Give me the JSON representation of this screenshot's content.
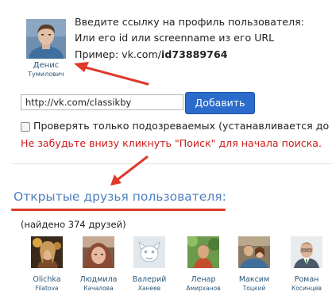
{
  "profile": {
    "first_name": "Денис",
    "last_name": "Тумилович"
  },
  "instructions": {
    "line1": "Введите ссылку на профиль пользователя:",
    "line2": "Или его id или screenname из его URL",
    "example_prefix": "Пример: vk.com/",
    "example_id": "id73889764"
  },
  "form": {
    "url_value": "http://vk.com/classikby",
    "add_button_label": "Добавить",
    "checkbox_label": "Проверять только подозреваемых (устанавливается до на",
    "checkbox_checked": false,
    "warning_text": "Не забудьте внизу кликнуть \"Поиск\" для начала поиска."
  },
  "friends_section": {
    "title": "Открытые друзья пользователя:",
    "count_text": "(найдено 374 друзей)"
  },
  "friends": [
    {
      "first": "Olichka",
      "last": "Filatova"
    },
    {
      "first": "Людмила",
      "last": "Качалова"
    },
    {
      "first": "Валерий",
      "last": "Ханеев"
    },
    {
      "first": "Ленар",
      "last": "Амирханов"
    },
    {
      "first": "Максим",
      "last": "Тоцкий"
    },
    {
      "first": "Роман",
      "last": "Косинцев"
    }
  ],
  "colors": {
    "link": "#2b587a",
    "section_title": "#4f7fbf",
    "button": "#2a6bcc",
    "warning": "#cc1a1a",
    "annotation": "#dd3a2a"
  },
  "icons": [
    "placeholder-dog-icon",
    "arrow-annotation"
  ]
}
